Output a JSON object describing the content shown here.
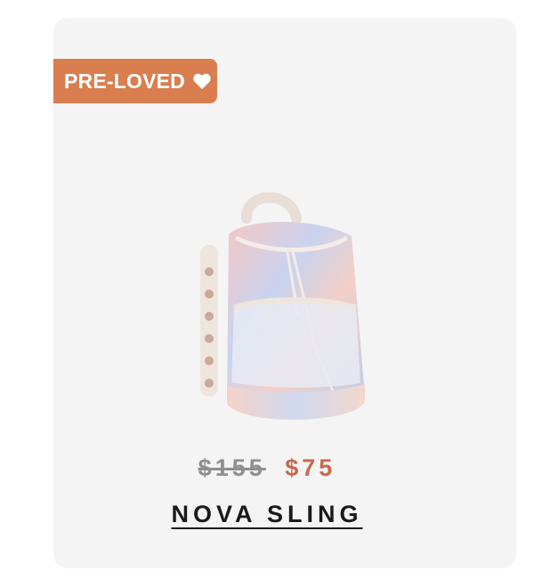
{
  "badge": {
    "label": "PRE-LOVED",
    "icon": "heart-icon",
    "color": "#d97e4f"
  },
  "product": {
    "image_icon": "backpack-image",
    "price_original": "$155",
    "price_sale": "$75",
    "sale_color": "#c8684a",
    "name": "NOVA SLING"
  }
}
